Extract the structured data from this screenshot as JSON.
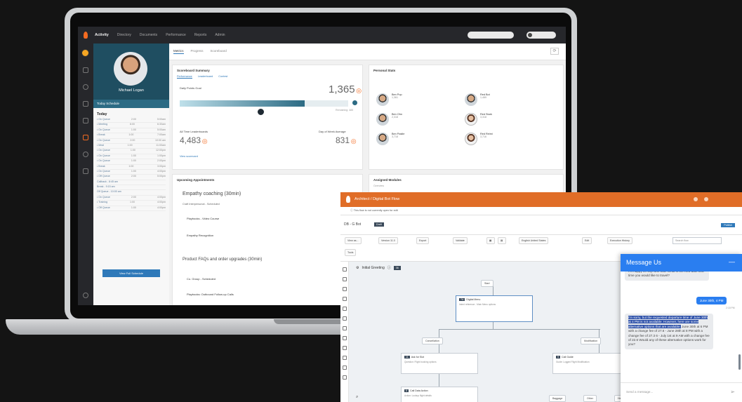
{
  "crm": {
    "brand": "Activity",
    "nav": [
      "Directory",
      "Documents",
      "Performance",
      "Reports",
      "Admin"
    ],
    "profile": {
      "name": "Michael Logan",
      "tab": "Today Schedule",
      "today": "Today",
      "schedule": [
        [
          "• On Queue",
          "2:00",
          "5:00am"
        ],
        [
          "• Meeting",
          "6:00",
          "6:30am"
        ],
        [
          "• On Queue",
          "1:00",
          "5:00am"
        ],
        [
          "• Break",
          "1:00",
          "7:00am"
        ],
        [
          "• On Queue",
          "2:00",
          "10:00 am"
        ],
        [
          "• Meal",
          "1:00",
          "11:00am"
        ],
        [
          "• On Queue",
          "1:00",
          "12:00pm"
        ],
        [
          "• On Queue",
          "1:00",
          "1:00pm"
        ],
        [
          "• On Queue",
          "1:00",
          "2:00pm"
        ],
        [
          "• Break",
          "1:00",
          "3:00pm"
        ],
        [
          "• On Queue",
          "1:00",
          "4:00pm"
        ],
        [
          "• Off Queue",
          "2:00",
          "5:00pm"
        ],
        [
          "Callback - 8:45 am",
          "",
          ""
        ],
        [
          "Break - 9:15 am",
          "",
          ""
        ],
        [
          "Off Queue - 10:00 am",
          "",
          ""
        ],
        [
          "• On Queue",
          "2:00",
          "4:00pm"
        ],
        [
          "• Training",
          "1:00",
          "4:00pm"
        ],
        [
          "• Off Queue",
          "1:00",
          "4:00pm"
        ]
      ],
      "button": "View Full Schedule"
    },
    "tabs": [
      "Metrics",
      "Progress",
      "Scoreboard"
    ],
    "scoreboard": {
      "title": "Scoreboard Summary",
      "subtabs": [
        "Performance",
        "Leaderboard",
        "Contest"
      ],
      "points_label": "Daily Points Goal",
      "points": "1,365",
      "goal_label": "Remaining: 485",
      "all_time_label": "All Time Leaderboards",
      "all_time": "4,483",
      "day_label": "Day of Week Average",
      "day_avg": "831",
      "link": "View scorecard"
    },
    "stats_title": "Personal Stats",
    "people": [
      {
        "name": "Ben Pop",
        "score": "1,361"
      },
      {
        "name": "Ben Ohn",
        "score": "2,318"
      },
      {
        "name": "Ben Pastle",
        "score": "3,718"
      },
      {
        "name": "Red Bot",
        "score": "1,489"
      },
      {
        "name": "Red Stark",
        "score": "3,318"
      },
      {
        "name": "Red Reimi",
        "score": "3,716"
      }
    ],
    "coaching": {
      "title": "Upcoming Appointments",
      "item1": "Empathy coaching (30min)",
      "item1b": "Craft Interpersonal - Scheduled",
      "item2": "Playbooks - Video Course",
      "item3": "Empathy Recognition",
      "item4": "Product FAQs and order upgrades (30min)",
      "item5": "Co. Group - Scheduled",
      "item6": "Playbooks: Outbound Follow-up Calls"
    },
    "assigned_title": "Assigned Modules",
    "assigned_sub": "Overview"
  },
  "architect": {
    "title": "Architect  /  Digital Bot Flow",
    "notice": "This flow is not currently open for edit",
    "version": "DB - G Bot",
    "badge": "Draft",
    "publish": "Publish",
    "toolbar": [
      "View as...",
      "Version 11.0",
      "Export",
      "Validate",
      "English United States",
      "Edit",
      "Execution History",
      "Tools"
    ],
    "search_placeholder": "Search flow",
    "greeting": "Initial Greeting",
    "greeting_num": "36",
    "start": "Start",
    "nodes": [
      {
        "id": "7A",
        "name": "Digital Menu",
        "desc": "Intent reference - Main Menu options"
      },
      {
        "id": "11",
        "name": "Ask for Slot",
        "desc": "Question: Flight booking options"
      },
      {
        "id": "8",
        "name": "Call Data Action",
        "desc": "Action: Lookup flight details"
      },
      {
        "id": "2",
        "name": "Call Data Action",
        "desc": ""
      },
      {
        "id": "9",
        "name": "Call Guide",
        "desc": "Guide: Logged Flight Modification"
      }
    ],
    "pills": [
      "Cancellation",
      "Modification",
      "Baggage",
      "Other",
      "Help"
    ]
  },
  "chat": {
    "title": "Message Us",
    "msg1": "I'm happy to help with that. What is the new date and time you would like to travel?",
    "msg2": "June 30th, 4 PM",
    "time2": "2:18 PM",
    "msg3_highlight": "I'm sorry, but the requested departure time of June 30th at 4 PM is not available. However, here are some alternative options that are available:",
    "msg3_rest": "June 30th at 6 PM with a change fee of 27.6 - June 28th at 8 PM with a change fee of 27.3 6 - July 1st at 9 AM with a change fee of 22.6 Would any of these alternative options work for you?",
    "placeholder": "Send a message...",
    "colors": {
      "header": "#2a7ef0",
      "bubble_user": "#2a7ef0",
      "selection": "#2a4ea8"
    }
  }
}
